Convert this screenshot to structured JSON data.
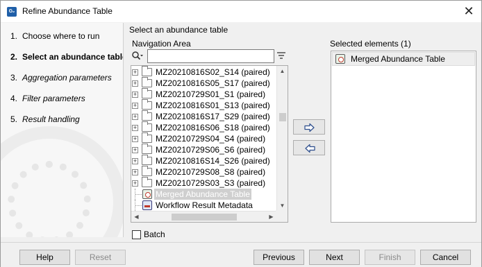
{
  "window": {
    "title": "Refine Abundance Table",
    "app_icon_text": "G₂",
    "close_glyph": "✕"
  },
  "steps": [
    {
      "num": "1.",
      "label": "Choose where to run"
    },
    {
      "num": "2.",
      "label": "Select an abundance table"
    },
    {
      "num": "3.",
      "label": "Aggregation parameters"
    },
    {
      "num": "4.",
      "label": "Filter parameters"
    },
    {
      "num": "5.",
      "label": "Result handling"
    }
  ],
  "main": {
    "section_title": "Select an abundance table",
    "navigation_title": "Navigation Area",
    "selected_title": "Selected elements (1)",
    "search": {
      "value": "",
      "placeholder": ""
    },
    "tree_items": [
      {
        "label": "MZ20210816S02_S14 (paired)",
        "icon": "folder-icon"
      },
      {
        "label": "MZ20210816S05_S17 (paired)",
        "icon": "folder-icon"
      },
      {
        "label": "MZ20210729S01_S1 (paired)",
        "icon": "folder-icon"
      },
      {
        "label": "MZ20210816S01_S13 (paired)",
        "icon": "folder-icon"
      },
      {
        "label": "MZ20210816S17_S29 (paired)",
        "icon": "folder-icon"
      },
      {
        "label": "MZ20210816S06_S18 (paired)",
        "icon": "folder-icon"
      },
      {
        "label": "MZ20210729S04_S4 (paired)",
        "icon": "folder-icon"
      },
      {
        "label": "MZ20210729S06_S6 (paired)",
        "icon": "folder-icon"
      },
      {
        "label": "MZ20210816S14_S26 (paired)",
        "icon": "folder-icon"
      },
      {
        "label": "MZ20210729S08_S8 (paired)",
        "icon": "folder-icon"
      },
      {
        "label": "MZ20210729S03_S3 (paired)",
        "icon": "folder-icon"
      },
      {
        "label": "Merged Abundance Table",
        "icon": "abundance-table-icon"
      },
      {
        "label": "Workflow Result Metadata",
        "icon": "workflow-metadata-icon"
      }
    ],
    "selected_items": [
      {
        "label": "Merged Abundance Table",
        "icon": "abundance-table-icon"
      }
    ],
    "batch_label": "Batch",
    "batch_checked": false
  },
  "footer": {
    "help": "Help",
    "reset": "Reset",
    "previous": "Previous",
    "next": "Next",
    "finish": "Finish",
    "cancel": "Cancel"
  }
}
